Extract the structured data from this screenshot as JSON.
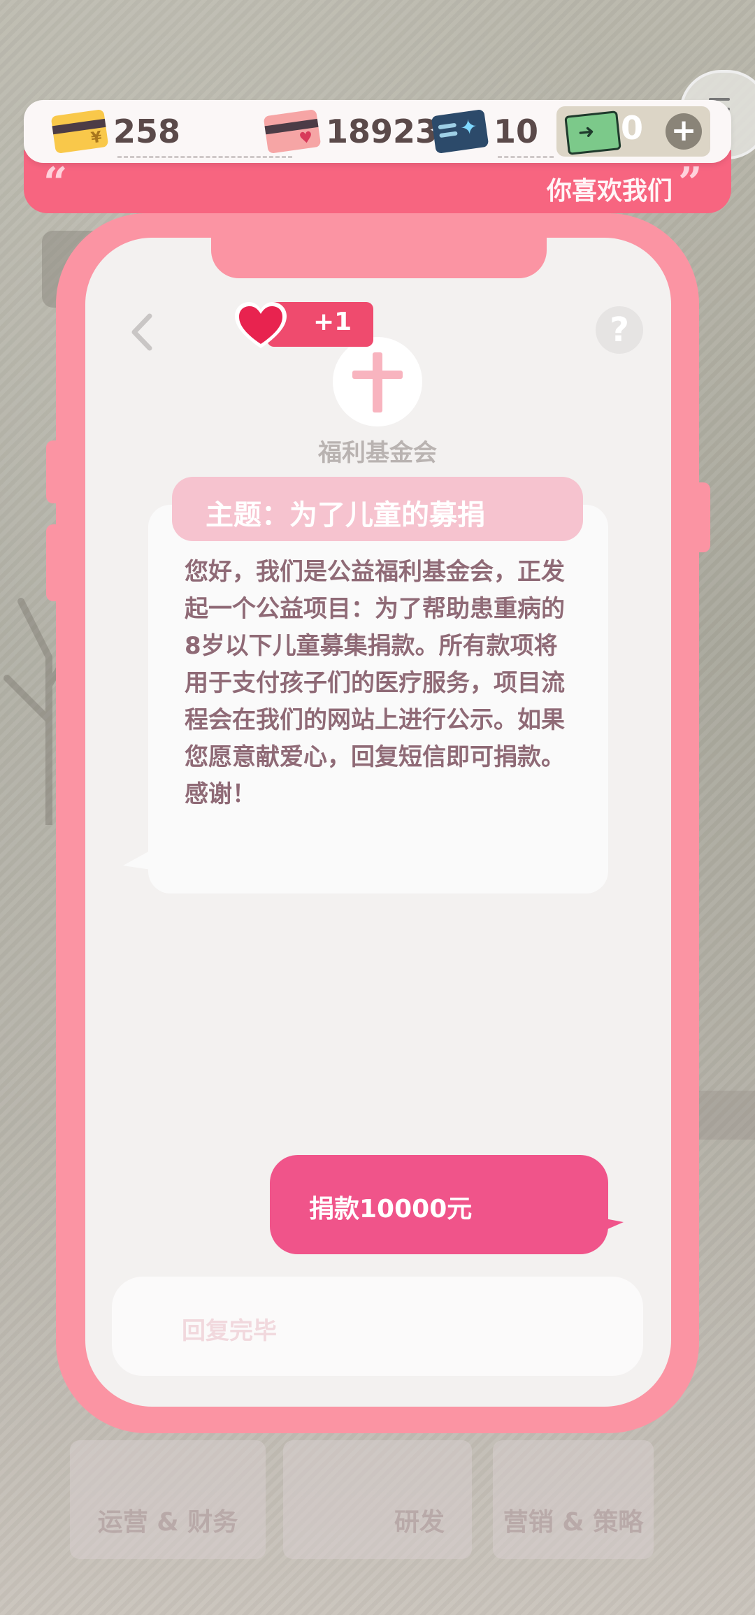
{
  "currencies": [
    {
      "icon": "credit-card-icon",
      "value": "258"
    },
    {
      "icon": "love-card-icon",
      "value": "18923"
    },
    {
      "icon": "research-card-icon",
      "value": "10"
    },
    {
      "icon": "cash-icon",
      "value": "0"
    }
  ],
  "quote_banner": {
    "open": "“",
    "text": "你喜欢我们",
    "close": "”"
  },
  "plus_label": "+",
  "phone": {
    "help_label": "?",
    "heart_badge": "+1",
    "sender_name": "福利基金会",
    "subject": "主题：为了儿童的募捐",
    "message": "您好，我们是公益福利基金会，正发起一个公益项目：为了帮助患重病的8岁以下儿童募集捐款。所有款项将用于支付孩子们的医疗服务，项目流程会在我们的网站上进行公示。如果您愿意献爱心，回复短信即可捐款。感谢！",
    "reply_option": "捐款10000元",
    "reply_done": "回复完毕"
  },
  "background_tabs": [
    "运营 & 财务",
    "研发",
    "营销 & 策略"
  ],
  "colors": {
    "accent": "#f76580",
    "phone_frame": "#fb94a3",
    "reply": "#f0548a",
    "message_text": "#8f6a76"
  }
}
